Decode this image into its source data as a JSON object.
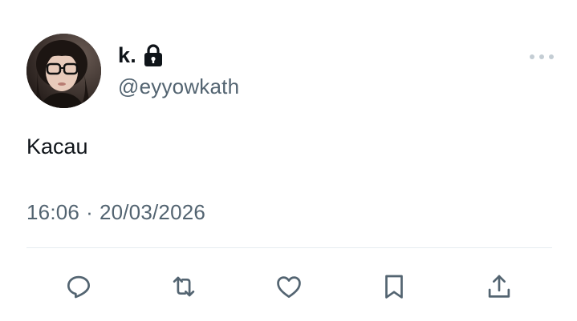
{
  "user": {
    "display_name": "k.",
    "handle": "@eyyowkath",
    "avatar_icon": "avatar",
    "protected_icon": "lock-icon"
  },
  "tweet": {
    "text": "Kacau",
    "time": "16:06",
    "separator": "·",
    "date": "20/03/2026"
  },
  "actions": [
    {
      "name": "reply",
      "icon": "reply-icon"
    },
    {
      "name": "retweet",
      "icon": "retweet-icon"
    },
    {
      "name": "like",
      "icon": "heart-icon"
    },
    {
      "name": "bookmark",
      "icon": "bookmark-icon"
    },
    {
      "name": "share",
      "icon": "share-icon"
    }
  ],
  "colors": {
    "primary_text": "#0f1419",
    "secondary_text": "#536471",
    "icon": "#536471",
    "divider": "#e6ecf0",
    "background": "#ffffff"
  }
}
